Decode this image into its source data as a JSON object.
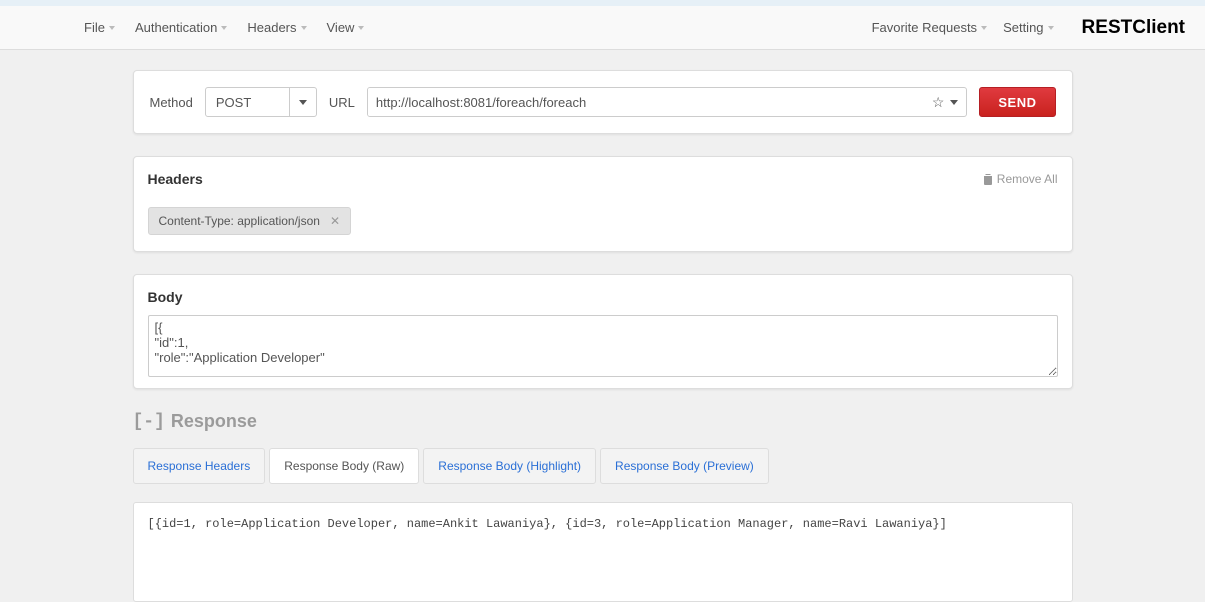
{
  "menu": {
    "left": [
      "File",
      "Authentication",
      "Headers",
      "View"
    ],
    "right": [
      "Favorite Requests",
      "Setting"
    ],
    "brand": "RESTClient"
  },
  "request": {
    "method_label": "Method",
    "method_value": "POST",
    "url_label": "URL",
    "url_value": "http://localhost:8081/foreach/foreach",
    "send_label": "SEND"
  },
  "headers_panel": {
    "title": "Headers",
    "remove_all": "Remove All",
    "chips": [
      "Content-Type: application/json"
    ]
  },
  "body_panel": {
    "title": "Body",
    "content": "[{\n\"id\":1,\n\"role\":\"Application Developer\""
  },
  "response": {
    "collapse": "[-]",
    "title": "Response",
    "tabs": [
      {
        "label": "Response Headers",
        "active": false
      },
      {
        "label": "Response Body (Raw)",
        "active": true
      },
      {
        "label": "Response Body (Highlight)",
        "active": false
      },
      {
        "label": "Response Body (Preview)",
        "active": false
      }
    ],
    "body": "[{id=1, role=Application Developer, name=Ankit Lawaniya}, {id=3, role=Application Manager, name=Ravi Lawaniya}]"
  }
}
